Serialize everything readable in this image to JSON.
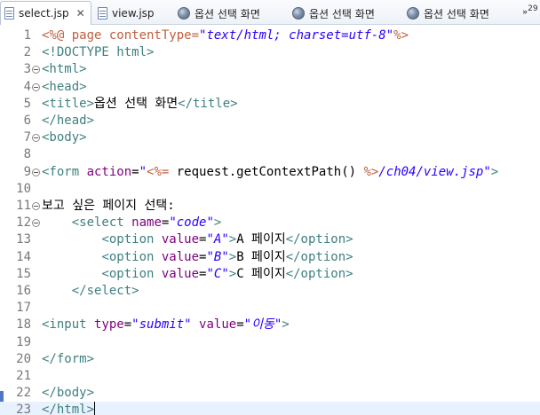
{
  "tabs": [
    {
      "label": "select.jsp",
      "icon": "jsp-file-icon",
      "active": true,
      "closable": true
    },
    {
      "label": "view.jsp",
      "icon": "jsp-file-icon",
      "active": false
    },
    {
      "label": "옵션 선택 화면",
      "icon": "browser-globe-icon",
      "active": false
    },
    {
      "label": "옵션 선택 화면",
      "icon": "browser-globe-icon",
      "active": false
    },
    {
      "label": "옵션 선택 화면",
      "icon": "browser-globe-icon",
      "active": false
    }
  ],
  "overflow": {
    "symbol": "»",
    "count": "29"
  },
  "editor": {
    "current_line": 23,
    "lines": [
      {
        "n": "1",
        "fold": false,
        "tokens": [
          [
            "dir",
            "<%@ page contentType="
          ],
          [
            "val",
            "\"text/html; charset=utf-8\""
          ],
          [
            "dir",
            "%>"
          ]
        ]
      },
      {
        "n": "2",
        "fold": false,
        "tokens": [
          [
            "tag",
            "<!DOCTYPE html>"
          ]
        ]
      },
      {
        "n": "3",
        "fold": true,
        "tokens": [
          [
            "tag",
            "<html>"
          ]
        ]
      },
      {
        "n": "4",
        "fold": true,
        "tokens": [
          [
            "tag",
            "<head>"
          ]
        ]
      },
      {
        "n": "5",
        "fold": false,
        "tokens": [
          [
            "tag",
            "<title>"
          ],
          [
            "text",
            "옵션 선택 화면"
          ],
          [
            "tag",
            "</title>"
          ]
        ]
      },
      {
        "n": "6",
        "fold": false,
        "tokens": [
          [
            "tag",
            "</head>"
          ]
        ]
      },
      {
        "n": "7",
        "fold": true,
        "tokens": [
          [
            "tag",
            "<body>"
          ]
        ]
      },
      {
        "n": "8",
        "fold": false,
        "tokens": []
      },
      {
        "n": "9",
        "fold": true,
        "tokens": [
          [
            "tag",
            "<form "
          ],
          [
            "attr",
            "action"
          ],
          [
            "text",
            "="
          ],
          [
            "val",
            "\""
          ],
          [
            "dir",
            "<%="
          ],
          [
            "java",
            " request.getContextPath() "
          ],
          [
            "dir",
            "%>"
          ],
          [
            "val",
            "/ch04/view.jsp\""
          ],
          [
            "tag",
            ">"
          ]
        ]
      },
      {
        "n": "10",
        "fold": false,
        "tokens": []
      },
      {
        "n": "11",
        "fold": true,
        "tokens": [
          [
            "text",
            "보고 싶은 페이지 선택:"
          ]
        ]
      },
      {
        "n": "12",
        "fold": true,
        "tokens": [
          [
            "text",
            "    "
          ],
          [
            "tag",
            "<select "
          ],
          [
            "attr",
            "name"
          ],
          [
            "text",
            "="
          ],
          [
            "val",
            "\"code\""
          ],
          [
            "tag",
            ">"
          ]
        ]
      },
      {
        "n": "13",
        "fold": false,
        "tokens": [
          [
            "text",
            "        "
          ],
          [
            "tag",
            "<option "
          ],
          [
            "attr",
            "value"
          ],
          [
            "text",
            "="
          ],
          [
            "val",
            "\"A\""
          ],
          [
            "tag",
            ">"
          ],
          [
            "text",
            "A 페이지"
          ],
          [
            "tag",
            "</option>"
          ]
        ]
      },
      {
        "n": "14",
        "fold": false,
        "tokens": [
          [
            "text",
            "        "
          ],
          [
            "tag",
            "<option "
          ],
          [
            "attr",
            "value"
          ],
          [
            "text",
            "="
          ],
          [
            "val",
            "\"B\""
          ],
          [
            "tag",
            ">"
          ],
          [
            "text",
            "B 페이지"
          ],
          [
            "tag",
            "</option>"
          ]
        ]
      },
      {
        "n": "15",
        "fold": false,
        "tokens": [
          [
            "text",
            "        "
          ],
          [
            "tag",
            "<option "
          ],
          [
            "attr",
            "value"
          ],
          [
            "text",
            "="
          ],
          [
            "val",
            "\"C\""
          ],
          [
            "tag",
            ">"
          ],
          [
            "text",
            "C 페이지"
          ],
          [
            "tag",
            "</option>"
          ]
        ]
      },
      {
        "n": "16",
        "fold": false,
        "tokens": [
          [
            "text",
            "    "
          ],
          [
            "tag",
            "</select>"
          ]
        ]
      },
      {
        "n": "17",
        "fold": false,
        "tokens": []
      },
      {
        "n": "18",
        "fold": false,
        "tokens": [
          [
            "tag",
            "<input "
          ],
          [
            "attr",
            "type"
          ],
          [
            "text",
            "="
          ],
          [
            "val",
            "\"submit\""
          ],
          [
            "text",
            " "
          ],
          [
            "attr",
            "value"
          ],
          [
            "text",
            "="
          ],
          [
            "val",
            "\"이동\""
          ],
          [
            "tag",
            ">"
          ]
        ]
      },
      {
        "n": "19",
        "fold": false,
        "tokens": []
      },
      {
        "n": "20",
        "fold": false,
        "tokens": [
          [
            "tag",
            "</form>"
          ]
        ]
      },
      {
        "n": "21",
        "fold": false,
        "tokens": []
      },
      {
        "n": "22",
        "fold": false,
        "tokens": [
          [
            "tag",
            "</body>"
          ]
        ]
      },
      {
        "n": "23",
        "fold": false,
        "tokens": [
          [
            "tag",
            "</html>"
          ]
        ]
      }
    ]
  }
}
